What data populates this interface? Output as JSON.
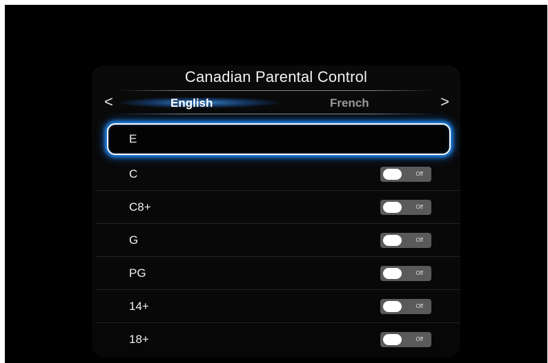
{
  "panel": {
    "title": "Canadian Parental Control"
  },
  "language_selector": {
    "left_arrow": "<",
    "right_arrow": ">",
    "options": [
      "English",
      "French"
    ],
    "selected": "English"
  },
  "ratings": [
    {
      "label": "E",
      "focused": true,
      "toggle": null
    },
    {
      "label": "C",
      "focused": false,
      "toggle": "Off"
    },
    {
      "label": "C8+",
      "focused": false,
      "toggle": "Off"
    },
    {
      "label": "G",
      "focused": false,
      "toggle": "Off"
    },
    {
      "label": "PG",
      "focused": false,
      "toggle": "Off"
    },
    {
      "label": "14+",
      "focused": false,
      "toggle": "Off"
    },
    {
      "label": "18+",
      "focused": false,
      "toggle": "Off"
    }
  ],
  "colors": {
    "background": "#000000",
    "focus_glow": "#2896ff",
    "toggle_track": "#5a5a5a",
    "toggle_knob": "#ffffff",
    "inactive_language": "#9a9a9a"
  }
}
